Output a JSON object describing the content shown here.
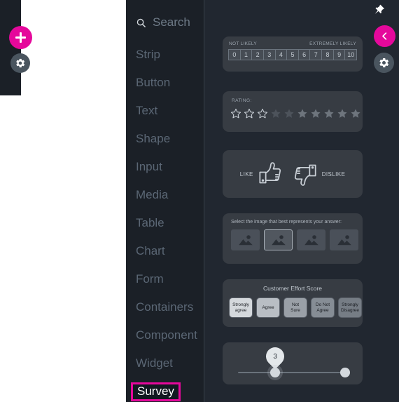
{
  "left_panel": {
    "add_button": "+",
    "gear_icon": "gear-icon",
    "accent_color": "#e5089b"
  },
  "sidebar": {
    "search": {
      "placeholder": "Search",
      "label": "Search",
      "icon": "search-icon"
    },
    "items": [
      {
        "label": "Strip",
        "selected": false
      },
      {
        "label": "Button",
        "selected": false
      },
      {
        "label": "Text",
        "selected": false
      },
      {
        "label": "Shape",
        "selected": false
      },
      {
        "label": "Input",
        "selected": false
      },
      {
        "label": "Media",
        "selected": false
      },
      {
        "label": "Table",
        "selected": false
      },
      {
        "label": "Chart",
        "selected": false
      },
      {
        "label": "Form",
        "selected": false
      },
      {
        "label": "Containers",
        "selected": false
      },
      {
        "label": "Component",
        "selected": false
      },
      {
        "label": "Widget",
        "selected": false
      },
      {
        "label": "Survey",
        "selected": true
      }
    ],
    "highlight_color": "#e5089b"
  },
  "preview": {
    "pin_icon": "pin-icon",
    "back_button": "back-chevron-icon",
    "gear_button": "gear-icon",
    "widgets": {
      "nps": {
        "left_label": "NOT LIKELY",
        "right_label": "EXTREMELY LIKELY",
        "values": [
          "0",
          "1",
          "2",
          "3",
          "4",
          "5",
          "6",
          "7",
          "8",
          "9",
          "10"
        ]
      },
      "rating": {
        "label": "RATING:",
        "total_stars": 10,
        "outline_stars": 3,
        "dim_filled_stars": 2,
        "filled_stars": 5
      },
      "like_dislike": {
        "like_label": "LIKE",
        "dislike_label": "DISLIKE",
        "like_icon": "thumbs-up-icon",
        "dislike_icon": "thumbs-down-icon"
      },
      "image_select": {
        "prompt": "Select the image that best represents your answer:",
        "tiles": 4,
        "selected_index": 1,
        "tile_icon": "image-placeholder-icon"
      },
      "ces": {
        "title": "Customer Effort Score",
        "options": [
          {
            "line1": "Strongly",
            "line2": "agree",
            "shade": "#d4d8dc"
          },
          {
            "line1": "Agree",
            "line2": "",
            "shade": "#b9bec4"
          },
          {
            "line1": "Not",
            "line2": "Sure",
            "shade": "#9aa0a7"
          },
          {
            "line1": "Do Not",
            "line2": "Agree",
            "shade": "#868d95"
          },
          {
            "line1": "Strongly",
            "line2": "Disagree",
            "shade": "#767d85"
          }
        ]
      },
      "slider": {
        "bubble_value": "3",
        "min_handle_percent": 30,
        "max_handle_percent": 93
      }
    }
  }
}
